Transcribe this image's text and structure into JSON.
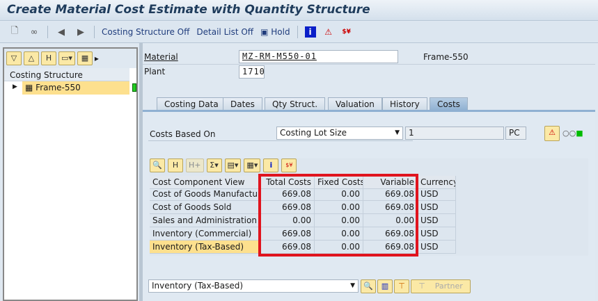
{
  "title": "Create Material Cost Estimate with Quantity Structure",
  "toolbar": {
    "costing_structure_off": "Costing Structure Off",
    "detail_list_off": "Detail List Off",
    "hold": "Hold"
  },
  "left": {
    "header": "Costing Structure",
    "tree_item": "Frame-550"
  },
  "header": {
    "material_label": "Material",
    "material_value": "MZ-RM-M550-01",
    "material_desc": "Frame-550",
    "plant_label": "Plant",
    "plant_value": "1710"
  },
  "tabs": [
    "Costing Data",
    "Dates",
    "Qty Struct.",
    "Valuation",
    "History",
    "Costs"
  ],
  "costs_based": {
    "label": "Costs Based On",
    "select": "Costing Lot Size",
    "qty": "1",
    "unit": "PC"
  },
  "table": {
    "headers": [
      "Cost Component View",
      "Total Costs",
      "Fixed Costs",
      "Variable",
      "Currency"
    ],
    "rows": [
      [
        "Cost of Goods Manufactur…",
        "669.08",
        "0.00",
        "669.08",
        "USD"
      ],
      [
        "Cost of Goods Sold",
        "669.08",
        "0.00",
        "669.08",
        "USD"
      ],
      [
        "Sales and Administration C…",
        "0.00",
        "0.00",
        "0.00",
        "USD"
      ],
      [
        "Inventory (Commercial)",
        "669.08",
        "0.00",
        "669.08",
        "USD"
      ],
      [
        "Inventory (Tax-Based)",
        "669.08",
        "0.00",
        "669.08",
        "USD"
      ]
    ]
  },
  "bottom": {
    "view_select": "Inventory (Tax-Based)",
    "partner": "Partner"
  },
  "colors": {
    "highlight": "#fde08e",
    "red_box": "#e0141e"
  }
}
